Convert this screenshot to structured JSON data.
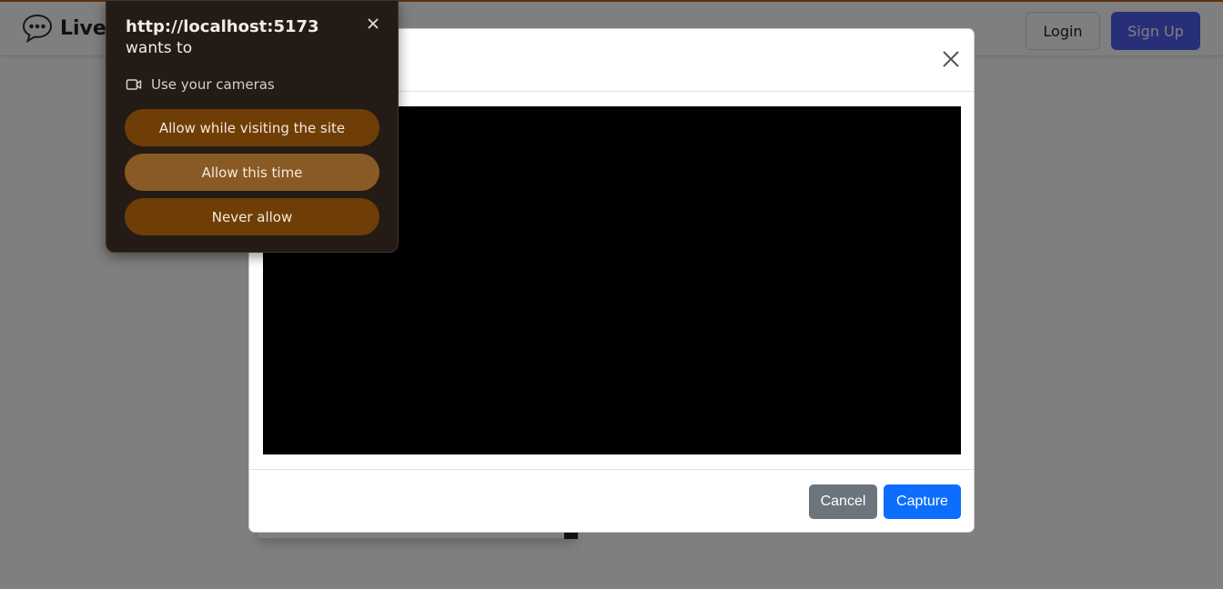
{
  "navbar": {
    "brand_text": "Live",
    "login_label": "Login",
    "signup_label": "Sign Up"
  },
  "modal": {
    "title": "",
    "cancel_label": "Cancel",
    "capture_label": "Capture"
  },
  "permission": {
    "origin": "http://localhost:5173",
    "wants_to": "wants to",
    "request_text": "Use your cameras",
    "allow_site_label": "Allow while visiting the site",
    "allow_once_label": "Allow this time",
    "never_label": "Never allow"
  },
  "colors": {
    "primary": "#0d6efd",
    "secondary": "#6c757d",
    "signup": "#4f5ff0",
    "popup_bg": "#241b16",
    "popup_button": "#6f3e06",
    "popup_button_active": "#8a5a24"
  },
  "icons": [
    "chat-bubble-icon",
    "close-icon",
    "camera-icon"
  ]
}
